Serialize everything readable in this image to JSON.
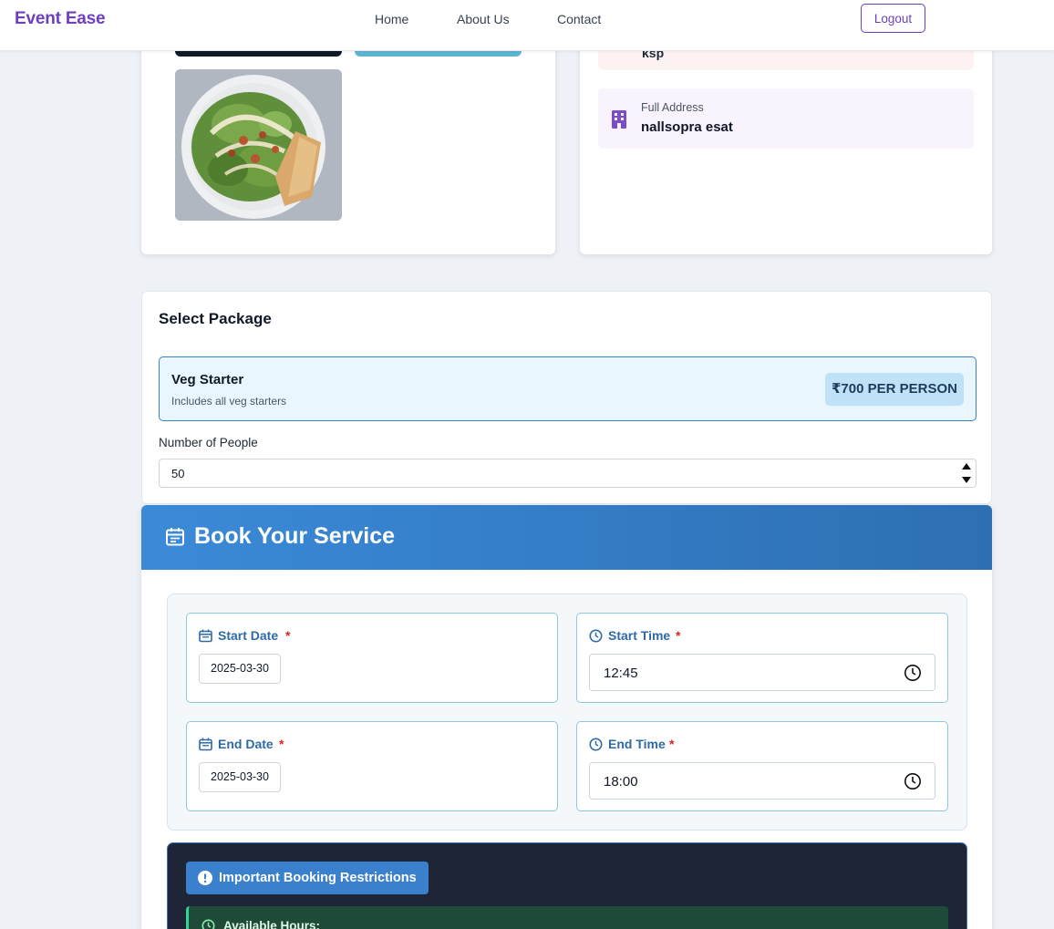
{
  "nav": {
    "brand": "Event Ease",
    "links": [
      "Home",
      "About Us",
      "Contact"
    ],
    "logout_label": "Logout"
  },
  "venue_info": {
    "partial_value": "ksp",
    "address_label": "Full Address",
    "address_value": "nallsopra esat"
  },
  "package": {
    "section_title": "Select Package",
    "option": {
      "name": "Veg Starter",
      "description": "Includes all veg starters",
      "price": "₹700 PER PERSON"
    },
    "people_label": "Number of People",
    "people_value": "50"
  },
  "booking": {
    "title": "Book Your Service",
    "start_date_label": "Start Date",
    "start_date_value": "2025-03-30",
    "start_time_label": "Start Time",
    "start_time_value": "12:45",
    "end_date_label": "End Date",
    "end_date_value": "2025-03-30",
    "end_time_label": "End Time",
    "end_time_value": "18:00",
    "required_mark": "*",
    "restrictions_title": "Important Booking Restrictions",
    "available_hours_title": "Available Hours:"
  },
  "colors": {
    "brand": "#6d3fc0",
    "header_blue": "#3b8ad8",
    "label_blue": "#2e6aa5",
    "required_red": "#dc2626",
    "restriction_bg": "#1e2536"
  },
  "icons": [
    "building-icon",
    "calendar-icon",
    "clock-icon",
    "alert-circle-icon"
  ]
}
